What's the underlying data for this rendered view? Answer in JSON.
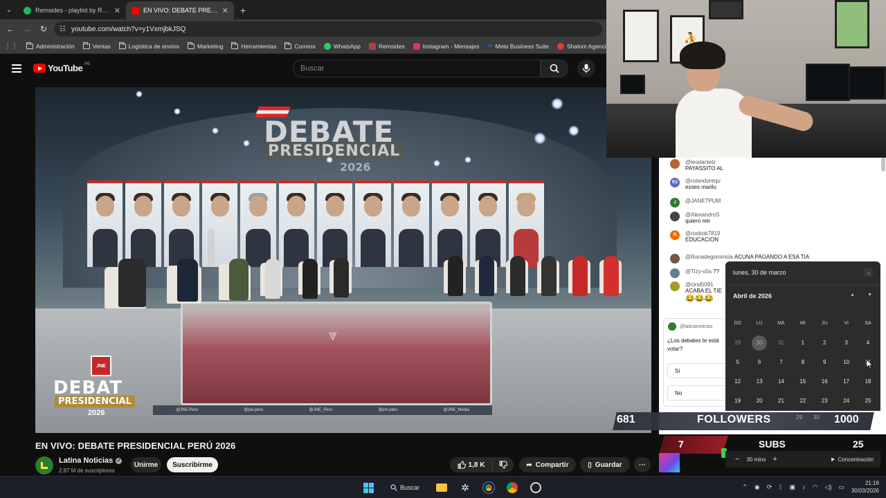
{
  "browser": {
    "tabs": [
      {
        "title": "Remsides - playlist by RemSide",
        "active": false,
        "favicon_color": "#1db954"
      },
      {
        "title": "EN VIVO: DEBATE PRESIDENCIAL",
        "active": true,
        "favicon_color": "#ff0000"
      }
    ],
    "url": "youtube.com/watch?v=y1VxmjbkJSQ",
    "bookmarks": [
      {
        "label": "Administración",
        "icon": "folder-icon"
      },
      {
        "label": "Ventas",
        "icon": "folder-icon"
      },
      {
        "label": "Logística de envíos",
        "icon": "folder-icon"
      },
      {
        "label": "Marketing",
        "icon": "folder-icon"
      },
      {
        "label": "Herramientas",
        "icon": "folder-icon"
      },
      {
        "label": "Correos",
        "icon": "folder-icon"
      },
      {
        "label": "WhatsApp",
        "icon": "whatsapp-icon",
        "color": "#25d366"
      },
      {
        "label": "Remsides",
        "icon": "remsides-icon",
        "color": "#b04040"
      },
      {
        "label": "Instagram - Mensajes",
        "icon": "instagram-icon",
        "color": "#e1306c"
      },
      {
        "label": "Meta Business Suite",
        "icon": "meta-icon",
        "color": "#1877f2"
      },
      {
        "label": "Shalom Agencias",
        "icon": "shalom-icon",
        "color": "#e53935"
      }
    ]
  },
  "youtube": {
    "logo_text": "YouTube",
    "country_code": "PE",
    "search_placeholder": "Buscar",
    "video_title": "EN VIVO: DEBATE PRESIDENCIAL PERÚ 2026",
    "channel_name": "Latina Noticias",
    "subscribers": "2,87 M de suscriptores",
    "join_label": "Unirme",
    "subscribe_label": "Suscribirme",
    "likes": "1,8 K",
    "share_label": "Compartir",
    "save_label": "Guardar",
    "more_label": "···"
  },
  "video_overlay": {
    "banner_title": "DEBATE",
    "banner_sub": "PRESIDENCIAL",
    "banner_year": "2026",
    "jne": "JNE",
    "debat": "DEBAT",
    "presidencial": "PRESIDENCIAL",
    "year": "2026",
    "socials": [
      "@JNE.Peru",
      "@jne.peru",
      "@JNE_Peru",
      "@jne.peru",
      "@JNE_Media"
    ]
  },
  "chat": {
    "messages": [
      {
        "user": "@leodanielz",
        "text": "PAYASSITO AL",
        "avatar_color": "#b5652f",
        "avatar_text": ""
      },
      {
        "user": "@rolandorequ",
        "text": "esses marilu",
        "avatar_color": "#5c6bc0",
        "avatar_text": "RZ"
      },
      {
        "user": "@JANETPUM",
        "text": "",
        "avatar_color": "#2e7d32",
        "avatar_text": "J"
      },
      {
        "user": "@AlexandroS",
        "text": "quiero reir",
        "avatar_color": "#444444",
        "avatar_text": ""
      },
      {
        "user": "@rosbob7819",
        "text": "EDUCACION",
        "avatar_color": "#ef6c00",
        "avatar_text": "R"
      },
      {
        "user": "@Ranadegominola",
        "text": "ACUNA PAGANDO A ESA TIA",
        "avatar_color": "#795548",
        "avatar_text": ""
      },
      {
        "user": "@Tizy-o5s",
        "text": "??",
        "avatar_color": "#607d8b",
        "avatar_text": ""
      },
      {
        "user": "@cind5091",
        "text": "ACABA EL TIE",
        "avatar_color": "#9e9d24",
        "avatar_text": ""
      }
    ],
    "emojis": "😂😂😂",
    "poll": {
      "channel": "@latinanoticias",
      "question": "¿Los debates te está votar?",
      "options": [
        "Sí",
        "No"
      ]
    }
  },
  "calendar": {
    "selected_date": "lunes, 30 de marzo",
    "month_title": "Abril de 2026",
    "weekdays": [
      "DO",
      "LU",
      "MA",
      "MI",
      "JU",
      "VI",
      "SA"
    ],
    "weeks": [
      [
        "29",
        "30",
        "31",
        "1",
        "2",
        "3",
        "4"
      ],
      [
        "5",
        "6",
        "7",
        "8",
        "9",
        "10",
        "11"
      ],
      [
        "12",
        "13",
        "14",
        "15",
        "16",
        "17",
        "18"
      ],
      [
        "19",
        "20",
        "21",
        "22",
        "23",
        "24",
        "25"
      ]
    ],
    "next_row_partial": [
      "29",
      "30"
    ],
    "focus_minus": "−",
    "focus_minutes": "30 mins",
    "focus_plus": "+",
    "focus_label": "Concentración"
  },
  "stream_overlay": {
    "followers_current": "681",
    "followers_label": "FOLLOWERS",
    "followers_goal": "1000",
    "subs_current": "7",
    "subs_label": "SUBS",
    "subs_goal": "25"
  },
  "taskbar": {
    "search_label": "Buscar",
    "time": "21:18",
    "date": "30/03/2026"
  }
}
